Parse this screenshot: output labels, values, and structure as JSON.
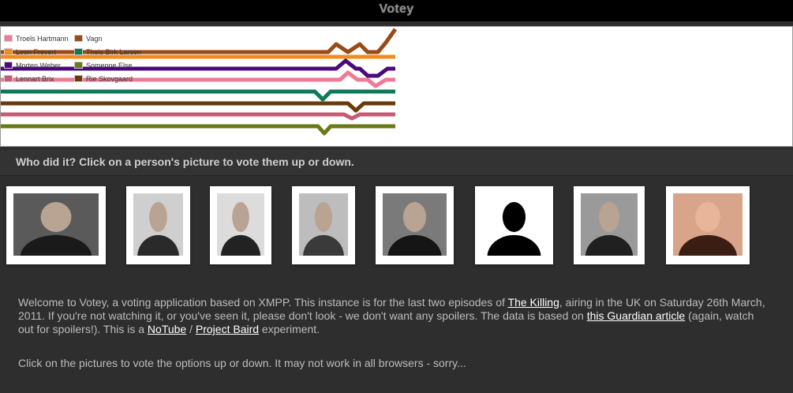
{
  "app": {
    "title": "Votey"
  },
  "legend": {
    "items": [
      {
        "name": "Troels Hartmann",
        "color": "#f07a96"
      },
      {
        "name": "Vagn",
        "color": "#9a4a14"
      },
      {
        "name": "Leon Frevert",
        "color": "#f28c1e"
      },
      {
        "name": "Theis Birk Larsen",
        "color": "#0c7a55"
      },
      {
        "name": "Morten Weber",
        "color": "#4a0a7a"
      },
      {
        "name": "Someone Else",
        "color": "#6a7a14"
      },
      {
        "name": "Lennart Brix",
        "color": "#c85a78"
      },
      {
        "name": "Rie Skovgaard",
        "color": "#6a3a0a"
      }
    ]
  },
  "prompt": {
    "text": "Who did it? Click on a person's picture to vote them up or down."
  },
  "candidates": [
    {
      "icon": "portrait-man-dark-jacket"
    },
    {
      "icon": "portrait-man-curly-hair"
    },
    {
      "icon": "portrait-man-bald"
    },
    {
      "icon": "portrait-man-grey-hair"
    },
    {
      "icon": "portrait-two-men"
    },
    {
      "icon": "silhouette-unknown"
    },
    {
      "icon": "portrait-man-shaved-head"
    },
    {
      "icon": "portrait-woman-dark-hair"
    }
  ],
  "intro": {
    "p1": "Welcome to Votey, a voting application based on XMPP. This instance is for the last two episodes of ",
    "link_killing": "The Killing",
    "p2": ", airing in the UK on Saturday 26th March, 2011. If you're not watching it, or you've seen it, please don't look - we don't want any spoilers. The data is based on ",
    "link_guardian": "this Guardian article",
    "p3": " (again, watch out for spoilers!). This is a ",
    "link_notube": "NoTube",
    "sep": " / ",
    "link_baird": "Project Baird",
    "p4": " experiment."
  },
  "note": {
    "text": "Click on the pictures to vote the options up or down. It may not work in all browsers - sorry..."
  }
}
